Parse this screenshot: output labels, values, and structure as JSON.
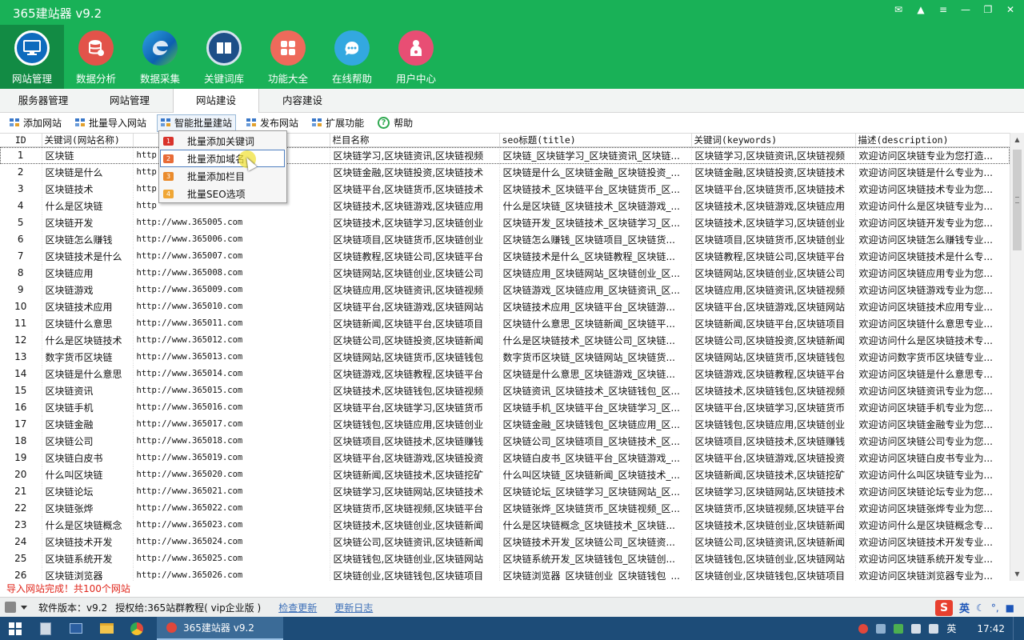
{
  "app": {
    "title": "365建站器 v9.2",
    "window_controls": [
      "message-icon",
      "shirt-icon",
      "menu-icon",
      "minimize-icon",
      "restore-icon",
      "close-icon"
    ]
  },
  "top_nav": [
    {
      "label": "网站管理",
      "icon": "monitor-icon",
      "color": "#0d6bbd",
      "active": true
    },
    {
      "label": "数据分析",
      "icon": "database-icon",
      "color": "#e2534a",
      "active": false
    },
    {
      "label": "数据采集",
      "icon": "edge-browser-icon",
      "color": "#1478c8",
      "active": false
    },
    {
      "label": "关键词库",
      "icon": "book-icon",
      "color": "#1d4f88",
      "active": false
    },
    {
      "label": "功能大全",
      "icon": "grid-icon",
      "color": "#ee6a5b",
      "active": false
    },
    {
      "label": "在线帮助",
      "icon": "chat-icon",
      "color": "#33a8e0",
      "active": false
    },
    {
      "label": "用户中心",
      "icon": "user-icon",
      "color": "#e84e74",
      "active": false
    }
  ],
  "sub_tabs": [
    "服务器管理",
    "网站管理",
    "网站建设",
    "内容建设"
  ],
  "toolbar": [
    "添加网站",
    "批量导入网站",
    "智能批量建站",
    "发布网站",
    "扩展功能",
    "帮助"
  ],
  "dropdown": [
    {
      "label": "批量添加关键词",
      "num": "1",
      "color": "#d9332b"
    },
    {
      "label": "批量添加域名",
      "num": "2",
      "color": "#e86b37"
    },
    {
      "label": "批量添加栏目",
      "num": "3",
      "color": "#ea8b2c"
    },
    {
      "label": "批量SEO选项",
      "num": "4",
      "color": "#f0a736"
    }
  ],
  "table": {
    "headers": [
      "ID",
      "关键词(网站名称)",
      "",
      "栏目名称",
      "seo标题(title)",
      "关键词(keywords)",
      "描述(description)"
    ],
    "rows": [
      [
        "1",
        "区块链",
        "http",
        "区块链学习,区块链资讯,区块链视频",
        "区块链_区块链学习_区块链资讯_区块链...",
        "区块链学习,区块链资讯,区块链视频",
        "欢迎访问区块链专业为您打造..."
      ],
      [
        "2",
        "区块链是什么",
        "http",
        "区块链金融,区块链投资,区块链技术",
        "区块链是什么_区块链金融_区块链投资_...",
        "区块链金融,区块链投资,区块链技术",
        "欢迎访问区块链是什么专业为..."
      ],
      [
        "3",
        "区块链技术",
        "http",
        "区块链平台,区块链货币,区块链技术",
        "区块链技术_区块链平台_区块链货币_区...",
        "区块链平台,区块链货币,区块链技术",
        "欢迎访问区块链技术专业为您..."
      ],
      [
        "4",
        "什么是区块链",
        "http",
        "区块链技术,区块链游戏,区块链应用",
        "什么是区块链_区块链技术_区块链游戏_...",
        "区块链技术,区块链游戏,区块链应用",
        "欢迎访问什么是区块链专业为..."
      ],
      [
        "5",
        "区块链开发",
        "http://www.365005.com",
        "区块链技术,区块链学习,区块链创业",
        "区块链开发_区块链技术_区块链学习_区...",
        "区块链技术,区块链学习,区块链创业",
        "欢迎访问区块链开发专业为您..."
      ],
      [
        "6",
        "区块链怎么赚钱",
        "http://www.365006.com",
        "区块链项目,区块链货币,区块链创业",
        "区块链怎么赚钱_区块链项目_区块链货...",
        "区块链项目,区块链货币,区块链创业",
        "欢迎访问区块链怎么赚钱专业..."
      ],
      [
        "7",
        "区块链技术是什么",
        "http://www.365007.com",
        "区块链教程,区块链公司,区块链平台",
        "区块链技术是什么_区块链教程_区块链...",
        "区块链教程,区块链公司,区块链平台",
        "欢迎访问区块链技术是什么专..."
      ],
      [
        "8",
        "区块链应用",
        "http://www.365008.com",
        "区块链网站,区块链创业,区块链公司",
        "区块链应用_区块链网站_区块链创业_区...",
        "区块链网站,区块链创业,区块链公司",
        "欢迎访问区块链应用专业为您..."
      ],
      [
        "9",
        "区块链游戏",
        "http://www.365009.com",
        "区块链应用,区块链资讯,区块链视频",
        "区块链游戏_区块链应用_区块链资讯_区...",
        "区块链应用,区块链资讯,区块链视频",
        "欢迎访问区块链游戏专业为您..."
      ],
      [
        "10",
        "区块链技术应用",
        "http://www.365010.com",
        "区块链平台,区块链游戏,区块链网站",
        "区块链技术应用_区块链平台_区块链游...",
        "区块链平台,区块链游戏,区块链网站",
        "欢迎访问区块链技术应用专业..."
      ],
      [
        "11",
        "区块链什么意思",
        "http://www.365011.com",
        "区块链新闻,区块链平台,区块链项目",
        "区块链什么意思_区块链新闻_区块链平...",
        "区块链新闻,区块链平台,区块链项目",
        "欢迎访问区块链什么意思专业..."
      ],
      [
        "12",
        "什么是区块链技术",
        "http://www.365012.com",
        "区块链公司,区块链投资,区块链新闻",
        "什么是区块链技术_区块链公司_区块链...",
        "区块链公司,区块链投资,区块链新闻",
        "欢迎访问什么是区块链技术专..."
      ],
      [
        "13",
        "数字货币区块链",
        "http://www.365013.com",
        "区块链网站,区块链货币,区块链钱包",
        "数字货币区块链_区块链网站_区块链货...",
        "区块链网站,区块链货币,区块链钱包",
        "欢迎访问数字货币区块链专业..."
      ],
      [
        "14",
        "区块链是什么意思",
        "http://www.365014.com",
        "区块链游戏,区块链教程,区块链平台",
        "区块链是什么意思_区块链游戏_区块链...",
        "区块链游戏,区块链教程,区块链平台",
        "欢迎访问区块链是什么意思专..."
      ],
      [
        "15",
        "区块链资讯",
        "http://www.365015.com",
        "区块链技术,区块链钱包,区块链视频",
        "区块链资讯_区块链技术_区块链钱包_区...",
        "区块链技术,区块链钱包,区块链视频",
        "欢迎访问区块链资讯专业为您..."
      ],
      [
        "16",
        "区块链手机",
        "http://www.365016.com",
        "区块链平台,区块链学习,区块链货币",
        "区块链手机_区块链平台_区块链学习_区...",
        "区块链平台,区块链学习,区块链货币",
        "欢迎访问区块链手机专业为您..."
      ],
      [
        "17",
        "区块链金融",
        "http://www.365017.com",
        "区块链钱包,区块链应用,区块链创业",
        "区块链金融_区块链钱包_区块链应用_区...",
        "区块链钱包,区块链应用,区块链创业",
        "欢迎访问区块链金融专业为您..."
      ],
      [
        "18",
        "区块链公司",
        "http://www.365018.com",
        "区块链项目,区块链技术,区块链赚钱",
        "区块链公司_区块链项目_区块链技术_区...",
        "区块链项目,区块链技术,区块链赚钱",
        "欢迎访问区块链公司专业为您..."
      ],
      [
        "19",
        "区块链白皮书",
        "http://www.365019.com",
        "区块链平台,区块链游戏,区块链投资",
        "区块链白皮书_区块链平台_区块链游戏_...",
        "区块链平台,区块链游戏,区块链投资",
        "欢迎访问区块链白皮书专业为..."
      ],
      [
        "20",
        "什么叫区块链",
        "http://www.365020.com",
        "区块链新闻,区块链技术,区块链挖矿",
        "什么叫区块链_区块链新闻_区块链技术_...",
        "区块链新闻,区块链技术,区块链挖矿",
        "欢迎访问什么叫区块链专业为..."
      ],
      [
        "21",
        "区块链论坛",
        "http://www.365021.com",
        "区块链学习,区块链网站,区块链技术",
        "区块链论坛_区块链学习_区块链网站_区...",
        "区块链学习,区块链网站,区块链技术",
        "欢迎访问区块链论坛专业为您..."
      ],
      [
        "22",
        "区块链张烨",
        "http://www.365022.com",
        "区块链货币,区块链视频,区块链平台",
        "区块链张烨_区块链货币_区块链视频_区...",
        "区块链货币,区块链视频,区块链平台",
        "欢迎访问区块链张烨专业为您..."
      ],
      [
        "23",
        "什么是区块链概念",
        "http://www.365023.com",
        "区块链技术,区块链创业,区块链新闻",
        "什么是区块链概念_区块链技术_区块链...",
        "区块链技术,区块链创业,区块链新闻",
        "欢迎访问什么是区块链概念专..."
      ],
      [
        "24",
        "区块链技术开发",
        "http://www.365024.com",
        "区块链公司,区块链资讯,区块链新闻",
        "区块链技术开发_区块链公司_区块链资...",
        "区块链公司,区块链资讯,区块链新闻",
        "欢迎访问区块链技术开发专业..."
      ],
      [
        "25",
        "区块链系统开发",
        "http://www.365025.com",
        "区块链钱包,区块链创业,区块链网站",
        "区块链系统开发_区块链钱包_区块链创...",
        "区块链钱包,区块链创业,区块链网站",
        "欢迎访问区块链系统开发专业..."
      ],
      [
        "26",
        "区块链浏览器",
        "http://www.365026.com",
        "区块链创业,区块链钱包,区块链项目",
        "区块链浏览器_区块链创业_区块链钱包_...",
        "区块链创业,区块链钱包,区块链项目",
        "欢迎访问区块链浏览器专业为..."
      ]
    ]
  },
  "status_message": "导入网站完成！共100个网站",
  "bottom_bar": {
    "version": "软件版本：v9.2",
    "license": "授权给:365站群教程( vip企业版 )",
    "check_update": "检查更新",
    "changelog": "更新日志",
    "ime_text": "英"
  },
  "taskbar": {
    "app_label": "365建站器 v9.2",
    "ime": "英",
    "clock": "17:42"
  }
}
